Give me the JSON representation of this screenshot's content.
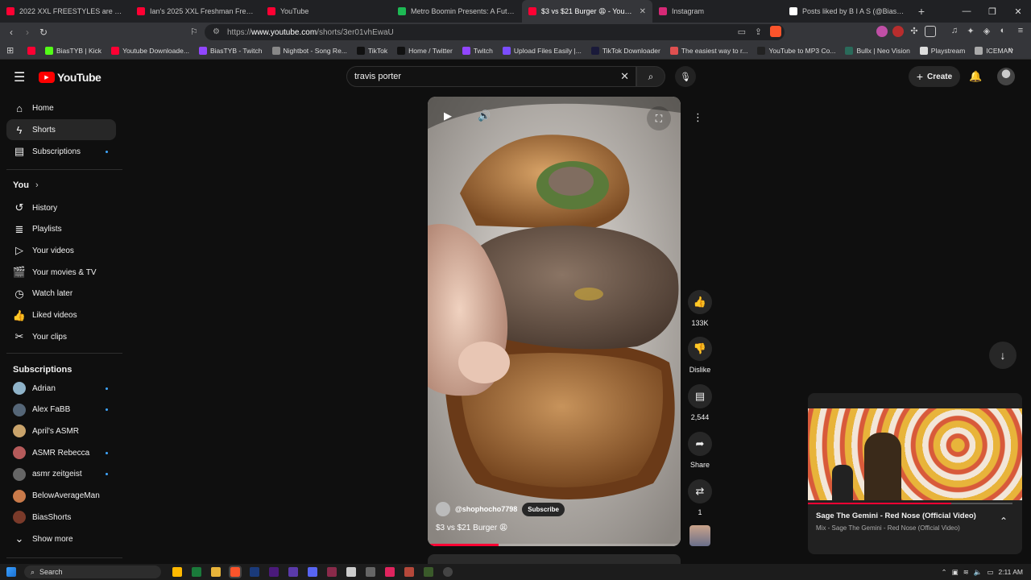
{
  "browser": {
    "tabs": [
      {
        "title": "2022 XXL FREESTYLES are Hilarious",
        "color": "#ff0033"
      },
      {
        "title": "Ian's 2025 XXL Freshman Freestyle -",
        "color": "#ff0033"
      },
      {
        "title": "YouTube",
        "color": "#ff0033"
      },
      {
        "title": "Metro Boomin Presents: A Futuristic",
        "color": "#1db954"
      },
      {
        "title": "$3 vs $21 Burger 😩 - YouTube",
        "color": "#ff0033",
        "active": true
      },
      {
        "title": "Instagram",
        "color": "#d62976"
      },
      {
        "title": "Posts liked by B I A S (@BiasTYB) / X",
        "color": "#ffffff"
      }
    ],
    "new_tab": "+",
    "url_prefix": "https://",
    "url_host": "www.youtube.com",
    "url_path": "/shorts/3er01vhEwaU",
    "bookmarks": [
      {
        "label": "",
        "color": "#ff0033"
      },
      {
        "label": "BiasTYB | Kick",
        "color": "#53fc18"
      },
      {
        "label": "Youtube Downloade...",
        "color": "#ff0033"
      },
      {
        "label": "BiasTYB - Twitch",
        "color": "#9146ff"
      },
      {
        "label": "Nightbot - Song Re...",
        "color": "#888888"
      },
      {
        "label": "TikTok",
        "color": "#111111"
      },
      {
        "label": "Home / Twitter",
        "color": "#111111"
      },
      {
        "label": "Twitch",
        "color": "#9146ff"
      },
      {
        "label": "Upload Files Easily |...",
        "color": "#7b4dff"
      },
      {
        "label": "TikTok Downloader",
        "color": "#1a1a3a"
      },
      {
        "label": "The easiest way to r...",
        "color": "#e05050"
      },
      {
        "label": "YouTube to MP3 Co...",
        "color": "#222222"
      },
      {
        "label": "Bullx | Neo Vision",
        "color": "#2a6a5a"
      },
      {
        "label": "Playstream",
        "color": "#dddddd"
      },
      {
        "label": "ICEMAN",
        "color": "#aaaaaa"
      }
    ]
  },
  "youtube": {
    "logo_text": "YouTube",
    "search_value": "travis porter",
    "create_label": "Create",
    "sidebar_main": [
      "Home",
      "Shorts",
      "Subscriptions"
    ],
    "you_label": "You",
    "sidebar_you": [
      "History",
      "Playlists",
      "Your videos",
      "Your movies & TV",
      "Watch later",
      "Liked videos",
      "Your clips"
    ],
    "subs_label": "Subscriptions",
    "subscriptions": [
      {
        "name": "Adrian",
        "color": "#8fb3c9",
        "dot": true
      },
      {
        "name": "Alex FaBB",
        "color": "#556677",
        "dot": true
      },
      {
        "name": "April's ASMR",
        "color": "#c9a36b",
        "dot": false
      },
      {
        "name": "ASMR Rebecca",
        "color": "#b55a5a",
        "dot": true
      },
      {
        "name": "asmr zeitgeist",
        "color": "#666666",
        "dot": true
      },
      {
        "name": "BelowAverageMan",
        "color": "#c97a4a",
        "dot": false
      },
      {
        "name": "BiasShorts",
        "color": "#7a3a2a",
        "dot": false
      }
    ],
    "show_more": "Show more",
    "short": {
      "channel": "@shophocho7798",
      "subscribe": "Subscribe",
      "title": "$3 vs $21 Burger 😩",
      "likes": "133K",
      "dislike": "Dislike",
      "comments": "2,544",
      "share": "Share",
      "remix": "1",
      "progress_fraction": 0.28
    },
    "mini_player": {
      "title": "Sage The Gemini - Red Nose (Official Video)",
      "subtitle": "Mix - Sage The Gemini - Red Nose (Official Video)",
      "progress_fraction": 0.7
    }
  },
  "taskbar": {
    "search_label": "Search",
    "time": "2:11 AM"
  }
}
